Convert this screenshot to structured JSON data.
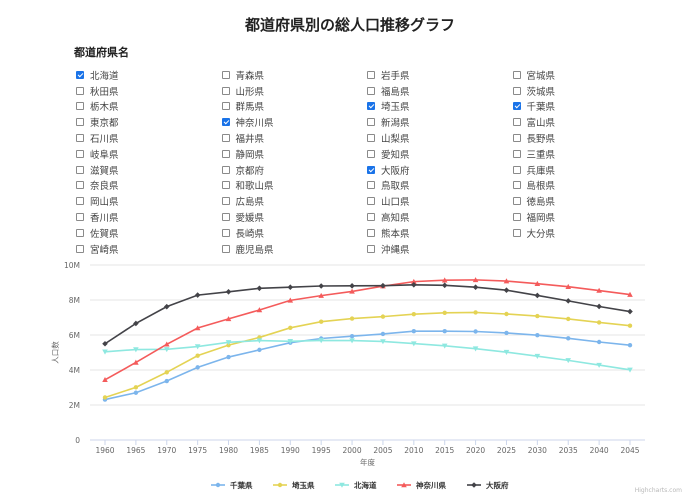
{
  "page": {
    "title": "都道府県別の総人口推移グラフ",
    "section_label": "都道府県名"
  },
  "prefectures": [
    {
      "name": "北海道",
      "checked": true
    },
    {
      "name": "青森県",
      "checked": false
    },
    {
      "name": "岩手県",
      "checked": false
    },
    {
      "name": "宮城県",
      "checked": false
    },
    {
      "name": "秋田県",
      "checked": false
    },
    {
      "name": "山形県",
      "checked": false
    },
    {
      "name": "福島県",
      "checked": false
    },
    {
      "name": "茨城県",
      "checked": false
    },
    {
      "name": "栃木県",
      "checked": false
    },
    {
      "name": "群馬県",
      "checked": false
    },
    {
      "name": "埼玉県",
      "checked": true
    },
    {
      "name": "千葉県",
      "checked": true
    },
    {
      "name": "東京都",
      "checked": false
    },
    {
      "name": "神奈川県",
      "checked": true
    },
    {
      "name": "新潟県",
      "checked": false
    },
    {
      "name": "富山県",
      "checked": false
    },
    {
      "name": "石川県",
      "checked": false
    },
    {
      "name": "福井県",
      "checked": false
    },
    {
      "name": "山梨県",
      "checked": false
    },
    {
      "name": "長野県",
      "checked": false
    },
    {
      "name": "岐阜県",
      "checked": false
    },
    {
      "name": "静岡県",
      "checked": false
    },
    {
      "name": "愛知県",
      "checked": false
    },
    {
      "name": "三重県",
      "checked": false
    },
    {
      "name": "滋賀県",
      "checked": false
    },
    {
      "name": "京都府",
      "checked": false
    },
    {
      "name": "大阪府",
      "checked": true
    },
    {
      "name": "兵庫県",
      "checked": false
    },
    {
      "name": "奈良県",
      "checked": false
    },
    {
      "name": "和歌山県",
      "checked": false
    },
    {
      "name": "鳥取県",
      "checked": false
    },
    {
      "name": "島根県",
      "checked": false
    },
    {
      "name": "岡山県",
      "checked": false
    },
    {
      "name": "広島県",
      "checked": false
    },
    {
      "name": "山口県",
      "checked": false
    },
    {
      "name": "徳島県",
      "checked": false
    },
    {
      "name": "香川県",
      "checked": false
    },
    {
      "name": "愛媛県",
      "checked": false
    },
    {
      "name": "高知県",
      "checked": false
    },
    {
      "name": "福岡県",
      "checked": false
    },
    {
      "name": "佐賀県",
      "checked": false
    },
    {
      "name": "長崎県",
      "checked": false
    },
    {
      "name": "熊本県",
      "checked": false
    },
    {
      "name": "大分県",
      "checked": false
    },
    {
      "name": "宮崎県",
      "checked": false
    },
    {
      "name": "鹿児島県",
      "checked": false
    },
    {
      "name": "沖縄県",
      "checked": false
    }
  ],
  "credit": "Highcharts.com",
  "chart_data": {
    "type": "line",
    "title": "",
    "xlabel": "年度",
    "ylabel": "人口数",
    "x": [
      1960,
      1965,
      1970,
      1975,
      1980,
      1985,
      1990,
      1995,
      2000,
      2005,
      2010,
      2015,
      2020,
      2025,
      2030,
      2035,
      2040,
      2045
    ],
    "ylim": [
      0,
      10000000
    ],
    "yticks": [
      0,
      2000000,
      4000000,
      6000000,
      8000000,
      10000000
    ],
    "ytick_labels": [
      "0",
      "2M",
      "4M",
      "6M",
      "8M",
      "10M"
    ],
    "grid": true,
    "legend_position": "bottom",
    "series": [
      {
        "name": "千葉県",
        "color": "#7cb5ec",
        "marker": "circle",
        "values": [
          2310000,
          2700000,
          3370000,
          4150000,
          4740000,
          5150000,
          5560000,
          5800000,
          5930000,
          6060000,
          6220000,
          6220000,
          6200000,
          6120000,
          5990000,
          5810000,
          5600000,
          5420000
        ]
      },
      {
        "name": "埼玉県",
        "color": "#e4d354",
        "marker": "circle",
        "values": [
          2430000,
          3010000,
          3870000,
          4820000,
          5420000,
          5860000,
          6410000,
          6760000,
          6940000,
          7050000,
          7190000,
          7270000,
          7290000,
          7200000,
          7080000,
          6920000,
          6720000,
          6530000
        ]
      },
      {
        "name": "北海道",
        "color": "#8ee8e0",
        "marker": "triangle-down",
        "values": [
          5040000,
          5170000,
          5180000,
          5340000,
          5580000,
          5680000,
          5640000,
          5690000,
          5680000,
          5630000,
          5510000,
          5380000,
          5220000,
          5020000,
          4790000,
          4550000,
          4280000,
          4010000
        ]
      },
      {
        "name": "神奈川県",
        "color": "#f45b5b",
        "marker": "triangle",
        "values": [
          3440000,
          4430000,
          5470000,
          6400000,
          6920000,
          7430000,
          7980000,
          8250000,
          8490000,
          8790000,
          9050000,
          9130000,
          9150000,
          9080000,
          8930000,
          8760000,
          8540000,
          8310000
        ]
      },
      {
        "name": "大阪府",
        "color": "#434348",
        "marker": "diamond",
        "values": [
          5500000,
          6660000,
          7620000,
          8280000,
          8470000,
          8670000,
          8730000,
          8800000,
          8810000,
          8820000,
          8870000,
          8840000,
          8730000,
          8560000,
          8260000,
          7950000,
          7630000,
          7340000
        ]
      }
    ]
  }
}
